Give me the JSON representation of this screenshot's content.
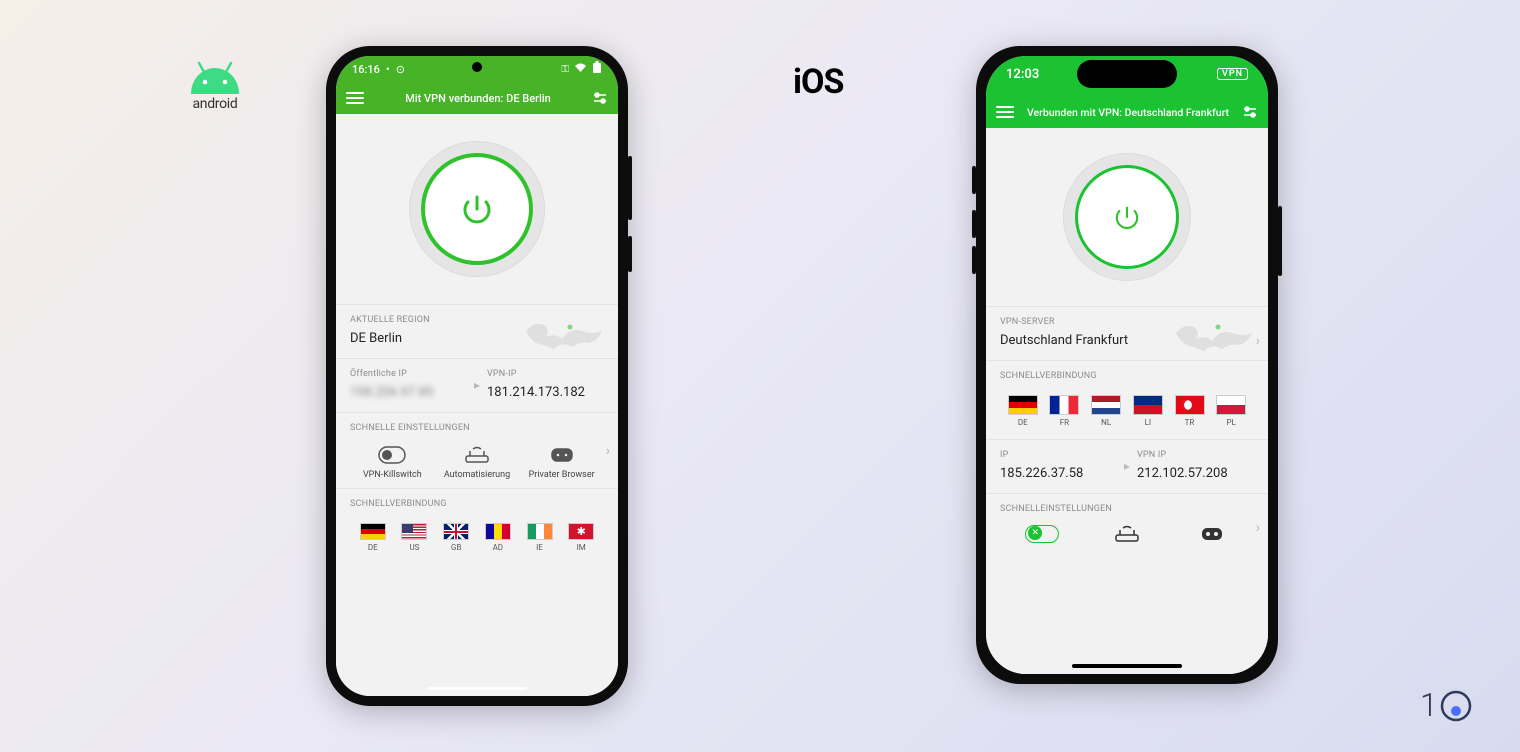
{
  "labels": {
    "android": "android",
    "ios": "iOS"
  },
  "android": {
    "status": {
      "time": "16:16"
    },
    "header": {
      "title": "Mit VPN verbunden: DE Berlin"
    },
    "region": {
      "label": "AKTUELLE REGION",
      "value": "DE Berlin"
    },
    "public_ip": {
      "label": "Öffentliche IP",
      "value": "198.206.97.89"
    },
    "vpn_ip": {
      "label": "VPN-IP",
      "value": "181.214.173.182"
    },
    "quick_settings": {
      "label": "SCHNELLE EINSTELLUNGEN",
      "items": [
        {
          "label": "VPN-Killswitch"
        },
        {
          "label": "Automatisierung"
        },
        {
          "label": "Privater Browser"
        }
      ]
    },
    "quick_connect": {
      "label": "SCHNELLVERBINDUNG",
      "items": [
        {
          "code": "DE",
          "flag": "de"
        },
        {
          "code": "US",
          "flag": "us"
        },
        {
          "code": "GB",
          "flag": "gb"
        },
        {
          "code": "AD",
          "flag": "ad"
        },
        {
          "code": "IE",
          "flag": "ie"
        },
        {
          "code": "IM",
          "flag": "im"
        }
      ]
    }
  },
  "ios": {
    "status": {
      "time": "12:03",
      "vpn_badge": "VPN"
    },
    "header": {
      "title": "Verbunden mit VPN: Deutschland Frankfurt"
    },
    "server": {
      "label": "VPN-SERVER",
      "value": "Deutschland Frankfurt"
    },
    "quick_connect": {
      "label": "SCHNELLVERBINDUNG",
      "items": [
        {
          "code": "DE",
          "flag": "de"
        },
        {
          "code": "FR",
          "flag": "fr"
        },
        {
          "code": "NL",
          "flag": "nl"
        },
        {
          "code": "LI",
          "flag": "li"
        },
        {
          "code": "TR",
          "flag": "tr"
        },
        {
          "code": "PL",
          "flag": "pl"
        }
      ]
    },
    "ip": {
      "label": "IP",
      "value": "185.226.37.58"
    },
    "vpn_ip": {
      "label": "VPN IP",
      "value": "212.102.57.208"
    },
    "quick_settings": {
      "label": "SCHNELLEINSTELLUNGEN"
    }
  }
}
